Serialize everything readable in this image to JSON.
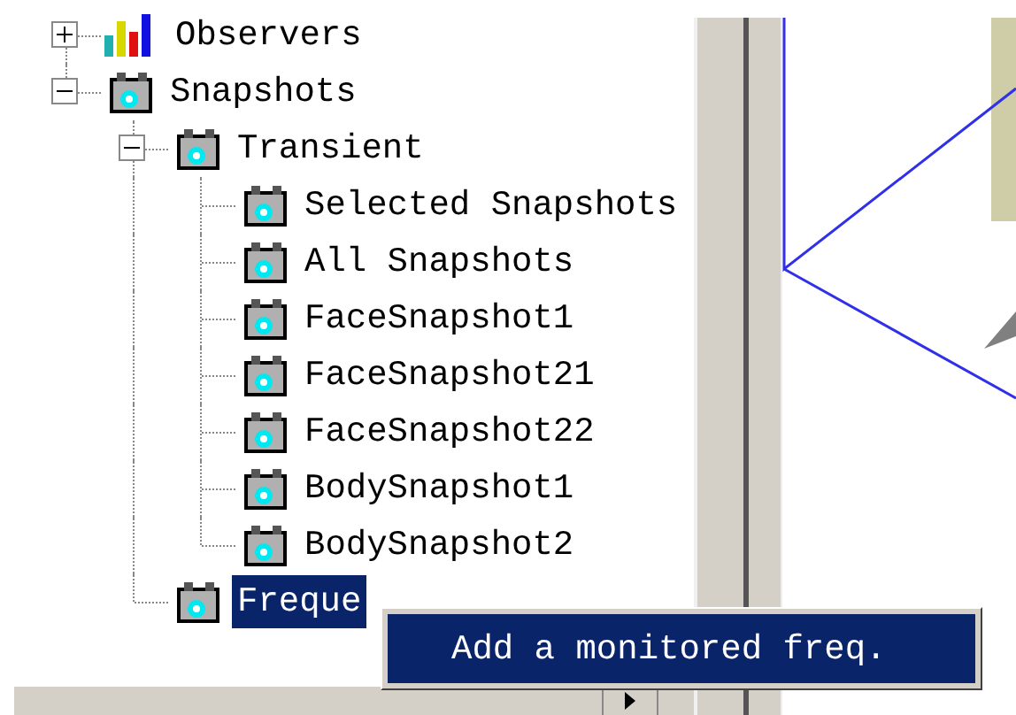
{
  "tree": [
    {
      "label": "Observers",
      "kind": "observers",
      "expanded": false,
      "selected": false
    },
    {
      "label": "Snapshots",
      "kind": "snapshot",
      "expanded": true,
      "selected": false,
      "children": [
        {
          "label": "Transient",
          "kind": "snapshot",
          "expanded": true,
          "selected": false,
          "children": [
            {
              "label": "Selected Snapshots",
              "kind": "snapshot",
              "selected": false
            },
            {
              "label": "All Snapshots",
              "kind": "snapshot",
              "selected": false
            },
            {
              "label": "FaceSnapshot1",
              "kind": "snapshot",
              "selected": false
            },
            {
              "label": "FaceSnapshot21",
              "kind": "snapshot",
              "selected": false
            },
            {
              "label": "FaceSnapshot22",
              "kind": "snapshot",
              "selected": false
            },
            {
              "label": "BodySnapshot1",
              "kind": "snapshot",
              "selected": false
            },
            {
              "label": "BodySnapshot2",
              "kind": "snapshot",
              "selected": false
            }
          ]
        },
        {
          "label": "Freque",
          "kind": "snapshot",
          "selected": true
        }
      ]
    }
  ],
  "context_menu": {
    "items": [
      {
        "label": "Add a monitored freq.",
        "selected": true
      }
    ]
  }
}
